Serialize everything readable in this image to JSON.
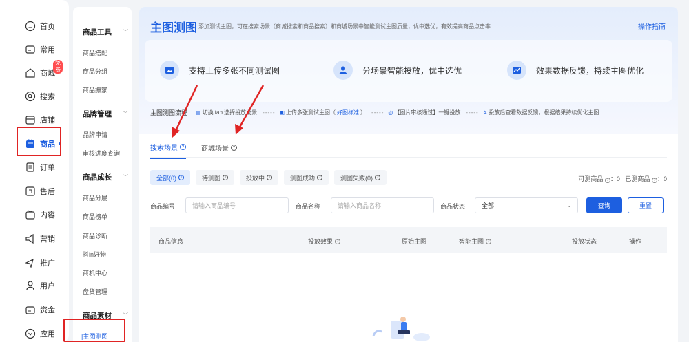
{
  "rail": {
    "items": [
      {
        "label": "首页",
        "icon": "home-icon"
      },
      {
        "label": "常用",
        "icon": "folder-icon"
      },
      {
        "label": "商城",
        "icon": "shop-icon",
        "badge": "免费"
      },
      {
        "label": "搜索",
        "icon": "search-icon"
      },
      {
        "label": "店铺",
        "icon": "store-icon"
      },
      {
        "label": "商品",
        "icon": "bag-icon",
        "active": true
      },
      {
        "label": "订单",
        "icon": "order-icon"
      },
      {
        "label": "售后",
        "icon": "aftersale-icon"
      },
      {
        "label": "内容",
        "icon": "content-icon"
      },
      {
        "label": "营销",
        "icon": "megaphone-icon"
      },
      {
        "label": "推广",
        "icon": "promote-icon"
      },
      {
        "label": "用户",
        "icon": "user-icon"
      },
      {
        "label": "资金",
        "icon": "wallet-icon"
      },
      {
        "label": "应用",
        "icon": "apps-icon"
      }
    ]
  },
  "submenu": {
    "groups": [
      {
        "title": "商品工具",
        "items": [
          "商品搭配",
          "商品分组",
          "商品搬家"
        ]
      },
      {
        "title": "品牌管理",
        "items": [
          "品牌申请",
          "审核进度查询"
        ]
      },
      {
        "title": "商品成长",
        "items": [
          "商品分层",
          "商品榜单",
          "商品诊断",
          "抖in好物",
          "商机中心",
          "盘货管理"
        ]
      },
      {
        "title": "商品素材",
        "items": [
          "主图测图"
        ]
      }
    ]
  },
  "header": {
    "title": "主图测图",
    "desc": "添加测试主图，可在搜索场景（商城搜索和商品搜索）和商城场景中智能测试主图质量，优中选优，有效提高商品点击率",
    "guide_link": "操作指南"
  },
  "features": [
    {
      "text": "支持上传多张不同测试图",
      "icon": "image-icon"
    },
    {
      "text": "分场景智能投放，优中选优",
      "icon": "person-icon"
    },
    {
      "text": "效果数据反馈，持续主图优化",
      "icon": "chart-icon"
    }
  ],
  "flow": {
    "label": "主图测图流程",
    "steps": [
      "切换 tab 选择投放场景",
      "上传多张测试主图（",
      "好图标准",
      "）",
      "【图片审核通过】一键投放",
      "投放后查看数据反馈，根据结果持续优化主图"
    ],
    "separator": "-----"
  },
  "tabs": [
    {
      "label": "搜索场景",
      "active": true
    },
    {
      "label": "商城场景"
    }
  ],
  "chips": [
    {
      "label": "全部(0)",
      "active": true
    },
    {
      "label": "待测图"
    },
    {
      "label": "投放中"
    },
    {
      "label": "测图成功"
    },
    {
      "label": "测图失败(0)"
    }
  ],
  "counts": {
    "testable_label": "可测商品",
    "testable_value": "：0",
    "tested_label": "已测商品",
    "tested_value": "：0"
  },
  "search": {
    "code_label": "商品编号",
    "code_placeholder": "请输入商品编号",
    "name_label": "商品名称",
    "name_placeholder": "请输入商品名称",
    "status_label": "商品状态",
    "status_value": "全部",
    "query_button": "查询",
    "reset_button": "重置"
  },
  "table": {
    "columns": [
      "商品信息",
      "投放效果",
      "原始主图",
      "智能主图",
      "投放状态",
      "操作"
    ]
  },
  "colors": {
    "accent": "#1d5fe0",
    "highlight_box": "#e02424",
    "badge": "#ff4d4f"
  }
}
